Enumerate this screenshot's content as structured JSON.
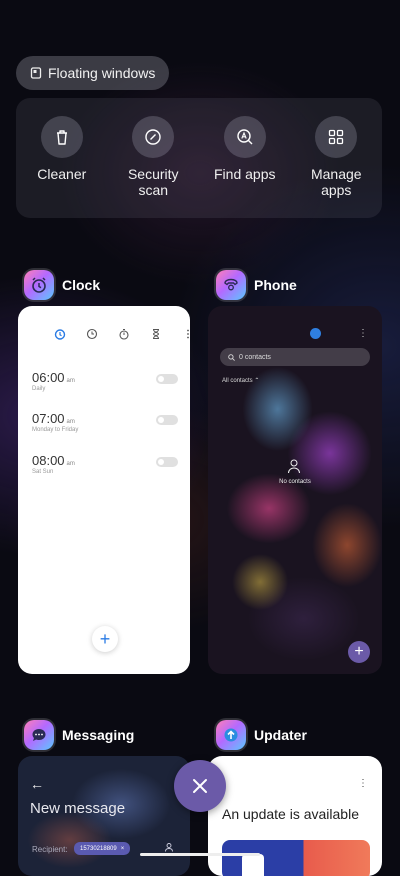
{
  "floating": {
    "label": "Floating windows"
  },
  "shortcuts": [
    {
      "label": "Cleaner",
      "icon": "trash-icon"
    },
    {
      "label": "Security scan",
      "icon": "shield-check-icon"
    },
    {
      "label": "Find apps",
      "icon": "search-app-icon"
    },
    {
      "label": "Manage apps",
      "icon": "grid-icon"
    }
  ],
  "apps": {
    "clock": {
      "name": "Clock",
      "alarms": [
        {
          "time": "06:00",
          "ampm": "am",
          "repeat": "Daily"
        },
        {
          "time": "07:00",
          "ampm": "am",
          "repeat": "Monday to Friday"
        },
        {
          "time": "08:00",
          "ampm": "am",
          "repeat": "Sat Sun"
        }
      ]
    },
    "phone": {
      "name": "Phone",
      "search_placeholder": "0 contacts",
      "filter": "All contacts",
      "empty_text": "No contacts"
    },
    "messaging": {
      "name": "Messaging",
      "title": "New message",
      "recipient_label": "Recipient:",
      "recipient_value": "15730218809"
    },
    "updater": {
      "name": "Updater",
      "title": "An update is available"
    }
  },
  "colors": {
    "accent": "#6b5aa8",
    "clock_blue": "#2a7be4"
  }
}
